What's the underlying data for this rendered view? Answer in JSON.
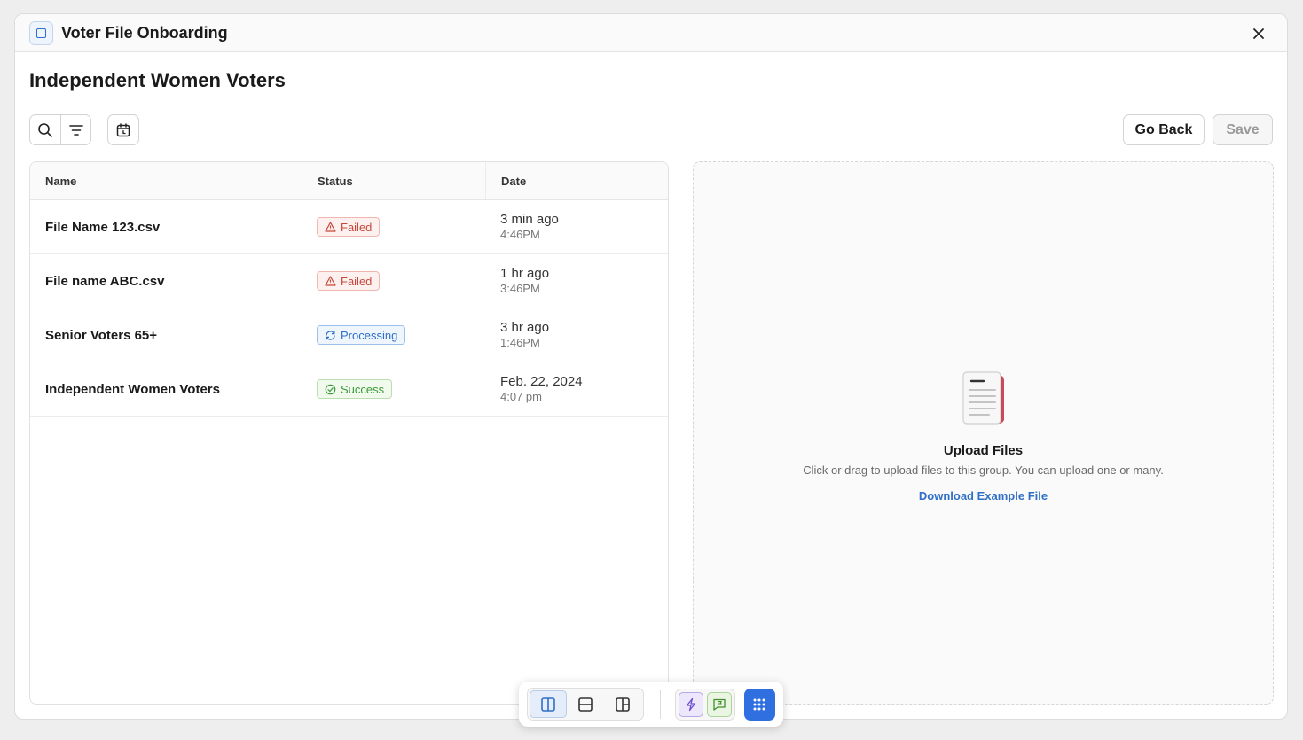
{
  "window": {
    "title": "Voter File Onboarding"
  },
  "page": {
    "title": "Independent Women Voters"
  },
  "actions": {
    "back_label": "Go Back",
    "save_label": "Save"
  },
  "table": {
    "columns": [
      "Name",
      "Status",
      "Date"
    ],
    "rows": [
      {
        "name": "File Name 123.csv",
        "status": "Failed",
        "date": "3 min ago",
        "time": "4:46PM"
      },
      {
        "name": "File name ABC.csv",
        "status": "Failed",
        "date": "1 hr ago",
        "time": "3:46PM"
      },
      {
        "name": "Senior Voters 65+",
        "status": "Processing",
        "date": "3 hr ago",
        "time": "1:46PM"
      },
      {
        "name": "Independent Women Voters",
        "status": "Success",
        "date": "Feb. 22, 2024",
        "time": "4:07 pm"
      }
    ]
  },
  "upload": {
    "title": "Upload Files",
    "description": "Click or drag to upload files to this group. You can upload one or many.",
    "link_label": "Download Example File"
  },
  "icons": {
    "toolbar": [
      "search-icon",
      "filter-icon",
      "calendar-icon"
    ],
    "dock": [
      "layout-split-vertical-icon",
      "layout-split-horizontal-icon",
      "layout-grid-icon",
      "lightning-icon",
      "chat-flag-icon",
      "apps-grid-icon"
    ]
  },
  "colors": {
    "accent": "#2f6fc7",
    "failed": "#c8473b",
    "processing": "#2f6fc7",
    "success": "#3b9a3b",
    "dock_primary": "#2f6fe0"
  }
}
